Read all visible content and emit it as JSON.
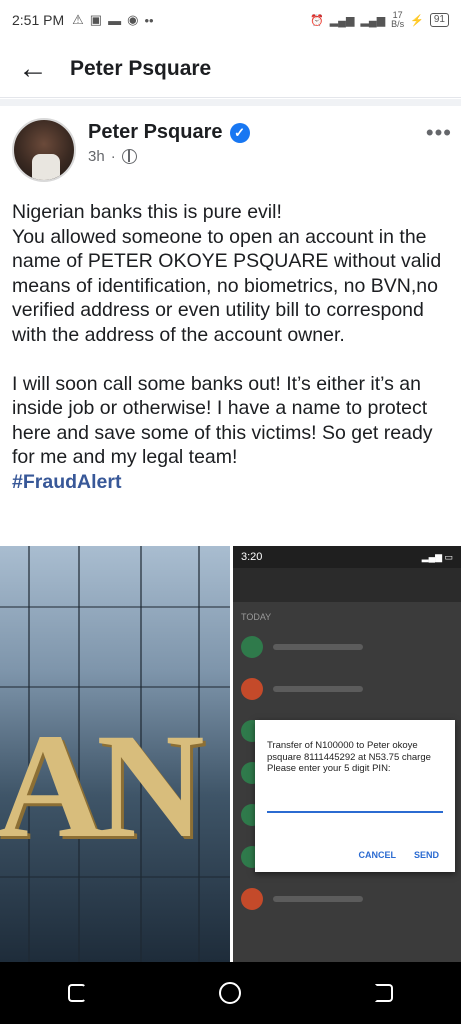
{
  "status_bar": {
    "time": "2:51 PM",
    "left_icons": [
      "warning-icon",
      "sim-icon",
      "message-icon",
      "chrome-icon",
      "more-dots-icon"
    ],
    "speed": "17\nB/s",
    "battery": "91"
  },
  "header": {
    "back_icon": "arrow-left-icon",
    "title": "Peter Psquare"
  },
  "post": {
    "author": "Peter Psquare",
    "verified_icon": "verified-check-icon",
    "time": "3h",
    "privacy_icon": "globe-icon",
    "more_icon": "more-horizontal-icon",
    "paragraph1": "Nigerian banks this is pure evil!\nYou allowed someone to open an account in the name of PETER OKOYE PSQUARE without valid means of identification, no biometrics, no BVN,no verified address or even utility bill to correspond with the address of the account owner.",
    "paragraph2": "I will soon call some banks out! It’s either it’s an inside job or otherwise! I have a name to protect here and save some of this victims! So get ready for me and my legal team!",
    "hashtag": "#FraudAlert"
  },
  "images": {
    "left_image_text": "AN",
    "phone": {
      "time": "3:20",
      "section": "TODAY",
      "dialog_message": "Transfer of N100000 to Peter okoye psquare 8111445292 at N53.75 charge\nPlease enter your 5 digit PIN:",
      "cancel_label": "CANCEL",
      "send_label": "SEND"
    }
  },
  "navbar": {
    "recent_icon": "recent-apps-icon",
    "home_icon": "home-circle-icon",
    "back_icon": "back-nav-icon"
  }
}
